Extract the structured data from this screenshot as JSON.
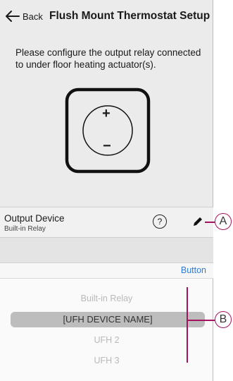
{
  "header": {
    "back_label": "Back",
    "title": "Flush Mount Thermostat Setup"
  },
  "instruction": "Please configure the output relay connected to under floor heating actuator(s).",
  "thermostat": {
    "plus": "+",
    "minus": "−"
  },
  "output_device": {
    "label": "Output Device",
    "value": "Built-in Relay",
    "help": "?"
  },
  "toolbar": {
    "button_label": "Button"
  },
  "picker": {
    "options": [
      "Built-in Relay",
      "[UFH DEVICE NAME]",
      "UFH 2",
      "UFH 3"
    ],
    "selected": "[UFH DEVICE NAME]"
  },
  "callouts": {
    "a": "A",
    "b": "B",
    "color": "#a3135f"
  }
}
